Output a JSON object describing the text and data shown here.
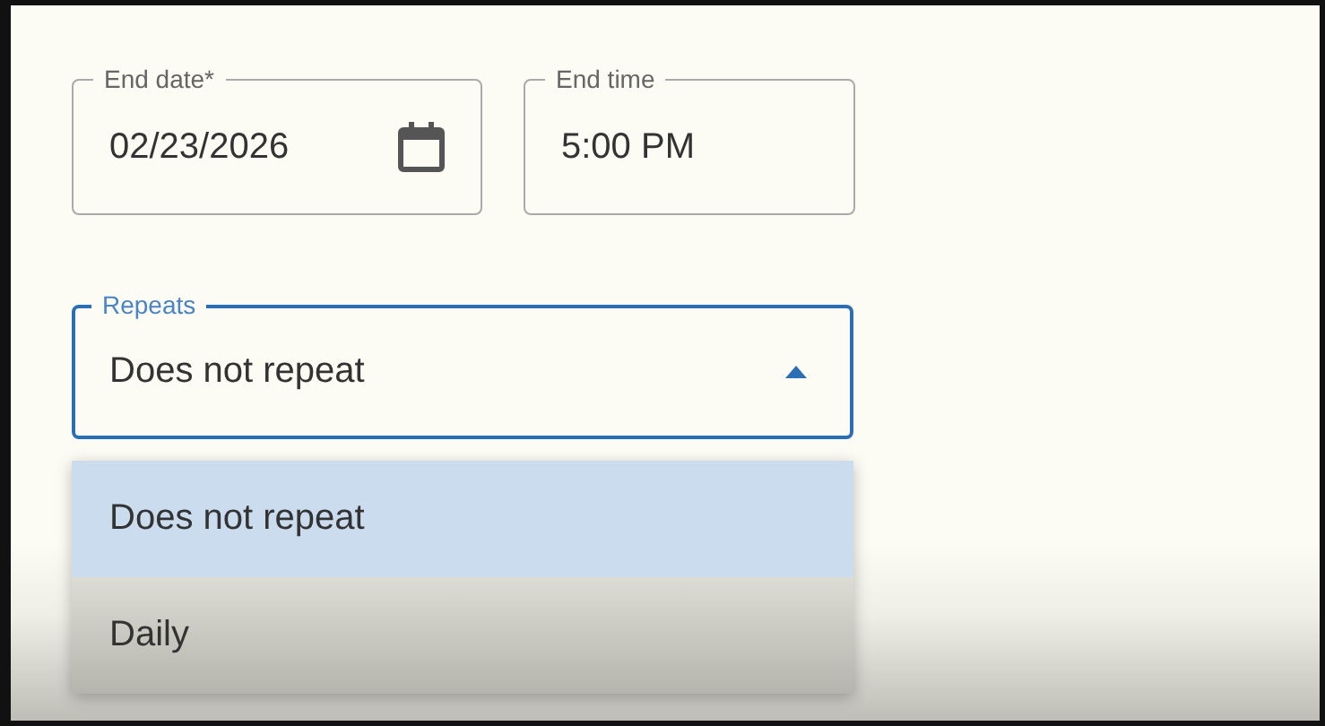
{
  "end_fields": [
    {
      "kind": "date",
      "label": "End date*",
      "value": "02/23/2026"
    },
    {
      "kind": "time",
      "label": "End time",
      "value": "5:00 PM"
    }
  ],
  "repeats": {
    "label": "Repeats",
    "value": "Does not repeat",
    "expanded": true,
    "options": [
      {
        "label": "Does not repeat",
        "selected": true
      },
      {
        "label": "Daily",
        "selected": false
      }
    ]
  }
}
